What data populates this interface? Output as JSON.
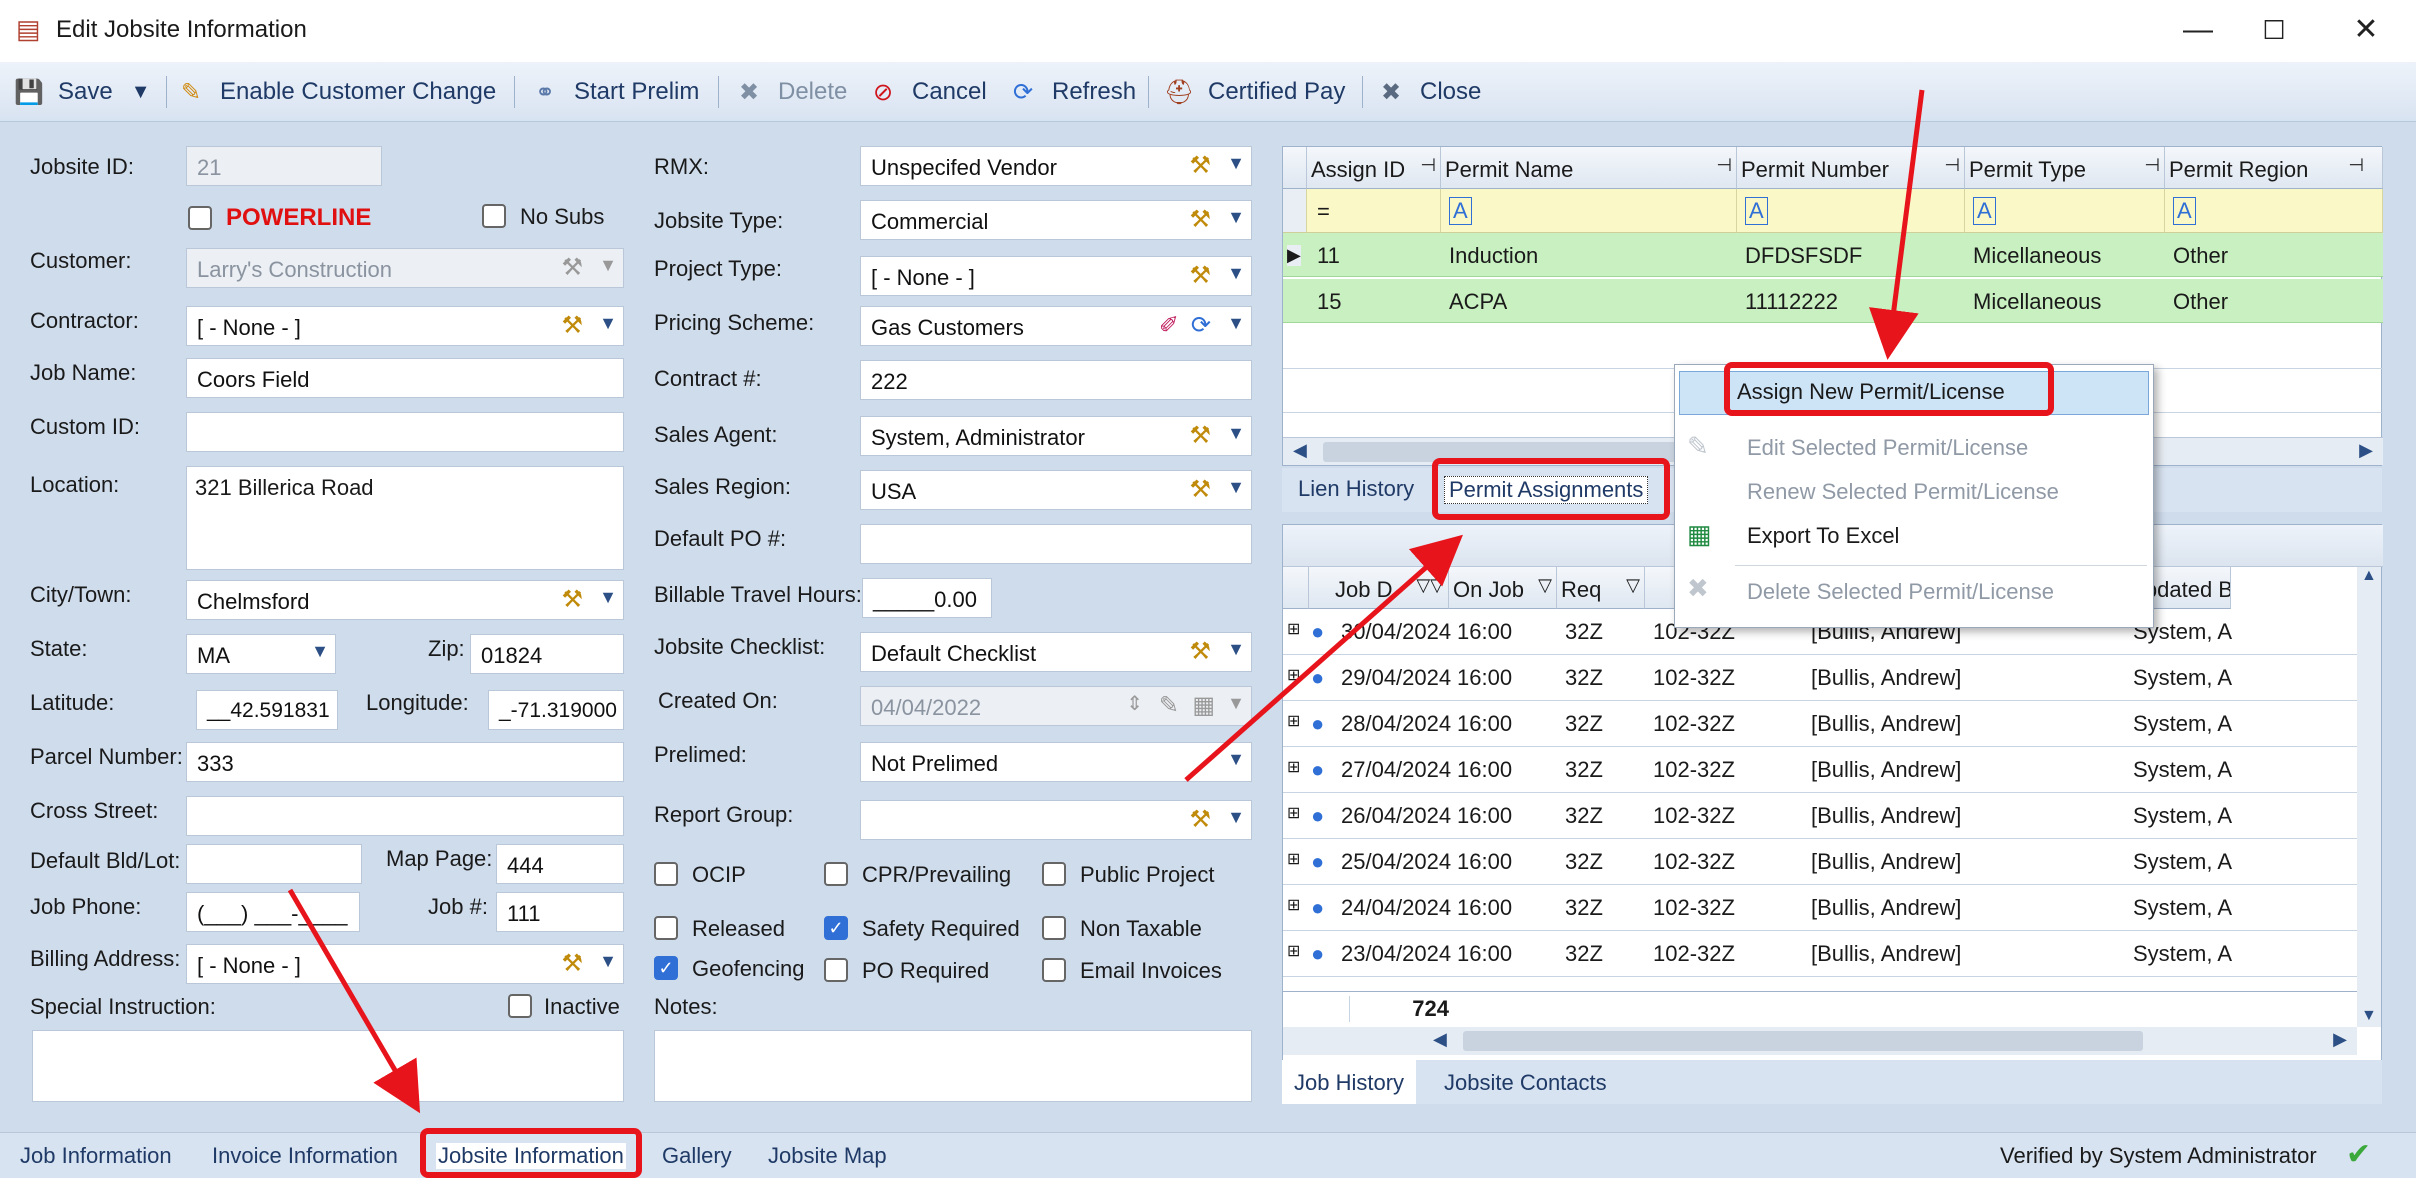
{
  "window": {
    "title": "Edit Jobsite Information",
    "minimize": "—",
    "maximize": "☐",
    "close": "✕"
  },
  "toolbar": {
    "save": "Save",
    "enable_customer_change": "Enable Customer Change",
    "start_prelim": "Start Prelim",
    "delete": "Delete",
    "cancel": "Cancel",
    "refresh": "Refresh",
    "certified_pay": "Certified Pay",
    "close": "Close"
  },
  "left": {
    "jobsite_id_label": "Jobsite ID:",
    "jobsite_id": "21",
    "powerline": "POWERLINE",
    "no_subs": "No Subs",
    "customer_label": "Customer:",
    "customer": "Larry's Construction",
    "contractor_label": "Contractor:",
    "contractor": "[ - None - ]",
    "job_name_label": "Job Name:",
    "job_name": "Coors Field",
    "custom_id_label": "Custom ID:",
    "custom_id": "",
    "location_label": "Location:",
    "location": "321 Billerica Road",
    "city_label": "City/Town:",
    "city": "Chelmsford",
    "state_label": "State:",
    "state": "MA",
    "zip_label": "Zip:",
    "zip": "01824",
    "latitude_label": "Latitude:",
    "latitude": "__42.591831",
    "longitude_label": "Longitude:",
    "longitude": "_-71.319000",
    "parcel_label": "Parcel Number:",
    "parcel": "333",
    "cross_street_label": "Cross Street:",
    "cross_street": "",
    "default_bld_label": "Default Bld/Lot:",
    "default_bld": "",
    "map_page_label": "Map Page:",
    "map_page": "444",
    "job_phone_label": "Job Phone:",
    "job_phone": "(___) ___-____",
    "job_no_label": "Job #:",
    "job_no": "111",
    "billing_label": "Billing Address:",
    "billing": "[ - None - ]",
    "special_label": "Special Instruction:",
    "inactive": "Inactive",
    "special": ""
  },
  "middle": {
    "rmx_label": "RMX:",
    "rmx": "Unspecifed Vendor",
    "jobsite_type_label": "Jobsite Type:",
    "jobsite_type": "Commercial",
    "project_type_label": "Project Type:",
    "project_type": "[ - None - ]",
    "pricing_label": "Pricing Scheme:",
    "pricing": "Gas Customers",
    "contract_label": "Contract #:",
    "contract": "222",
    "sales_agent_label": "Sales Agent:",
    "sales_agent": "System, Administrator",
    "sales_region_label": "Sales Region:",
    "sales_region": "USA",
    "default_po_label": "Default PO #:",
    "default_po": "",
    "billable_label": "Billable Travel Hours:",
    "billable": "_____0.00",
    "checklist_label": "Jobsite Checklist:",
    "checklist": "Default Checklist",
    "created_label": "Created On:",
    "created": "04/04/2022",
    "prelimed_label": "Prelimed:",
    "prelimed": "Not Prelimed",
    "report_group_label": "Report Group:",
    "report_group": "",
    "ocip": "OCIP",
    "cpr": "CPR/Prevailing",
    "public_project": "Public Project",
    "released": "Released",
    "safety": "Safety Required",
    "non_taxable": "Non Taxable",
    "geofencing": "Geofencing",
    "po_required": "PO Required",
    "email_invoices": "Email Invoices",
    "notes_label": "Notes:",
    "notes": ""
  },
  "permits": {
    "columns": [
      "Assign ID",
      "Permit Name",
      "Permit Number",
      "Permit Type",
      "Permit Region"
    ],
    "rows": [
      [
        "11",
        "Induction",
        "DFDSFSDF",
        "Micellaneous",
        "Other"
      ],
      [
        "15",
        "ACPA",
        "11112222",
        "Micellaneous",
        "Other"
      ]
    ],
    "filter_eq": "=",
    "filter_a": "A"
  },
  "tabs_top": {
    "lien_history": "Lien History",
    "permit_assignments": "Permit Assignments"
  },
  "context_menu": {
    "assign_new": "Assign New Permit/License",
    "edit_selected": "Edit Selected Permit/License",
    "renew_selected": "Renew Selected Permit/License",
    "export_excel": "Export To Excel",
    "delete_selected": "Delete Selected Permit/License"
  },
  "job_history": {
    "columns": [
      "Job D",
      "On Job",
      "Req",
      "",
      "Updated B"
    ],
    "rows": [
      [
        "30/04/2024",
        "16:00",
        "32Z",
        "102-32Z",
        "[Bullis, Andrew]",
        "System, A"
      ],
      [
        "29/04/2024",
        "16:00",
        "32Z",
        "102-32Z",
        "[Bullis, Andrew]",
        "System, A"
      ],
      [
        "28/04/2024",
        "16:00",
        "32Z",
        "102-32Z",
        "[Bullis, Andrew]",
        "System, A"
      ],
      [
        "27/04/2024",
        "16:00",
        "32Z",
        "102-32Z",
        "[Bullis, Andrew]",
        "System, A"
      ],
      [
        "26/04/2024",
        "16:00",
        "32Z",
        "102-32Z",
        "[Bullis, Andrew]",
        "System, A"
      ],
      [
        "25/04/2024",
        "16:00",
        "32Z",
        "102-32Z",
        "[Bullis, Andrew]",
        "System, A"
      ],
      [
        "24/04/2024",
        "16:00",
        "32Z",
        "102-32Z",
        "[Bullis, Andrew]",
        "System, A"
      ],
      [
        "23/04/2024",
        "16:00",
        "32Z",
        "102-32Z",
        "[Bullis, Andrew]",
        "System, A"
      ]
    ],
    "total": "724"
  },
  "tabs_bottom": {
    "job_history": "Job History",
    "jobsite_contacts": "Jobsite Contacts"
  },
  "statusbar": {
    "job_information": "Job Information",
    "invoice_information": "Invoice Information",
    "jobsite_information": "Jobsite Information",
    "gallery": "Gallery",
    "jobsite_map": "Jobsite Map",
    "verified": "Verified by System Administrator"
  }
}
